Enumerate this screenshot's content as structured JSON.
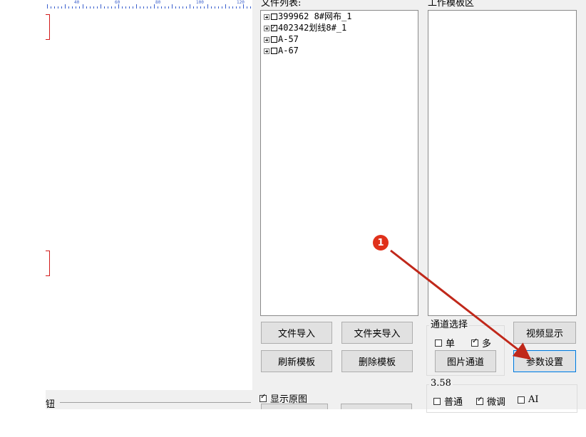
{
  "canvas": {
    "ruler_labels": [
      "40",
      "60",
      "80",
      "100",
      "120"
    ]
  },
  "bottom_strip": {
    "label": "钮"
  },
  "file_list": {
    "label": "文件列表:",
    "items": [
      {
        "name": "399962   8#网布_1",
        "checked": false
      },
      {
        "name": "402342划线8#_1",
        "checked": true
      },
      {
        "name": "A-57",
        "checked": false
      },
      {
        "name": "A-67",
        "checked": false
      }
    ]
  },
  "work_template": {
    "label": "工作模板区"
  },
  "buttons": {
    "file_import": "文件导入",
    "folder_import": "文件夹导入",
    "refresh_template": "刷新模板",
    "delete_template": "删除模板",
    "image_channel": "图片通道",
    "video_display": "视频显示",
    "param_settings": "参数设置"
  },
  "channel_select": {
    "label": "通道选择",
    "single": {
      "label": "单",
      "checked": false
    },
    "multi": {
      "label": "多",
      "checked": true
    }
  },
  "show_original": {
    "label": "显示原图",
    "checked": true
  },
  "status": {
    "value": "3.58",
    "normal": {
      "label": "普通",
      "checked": false
    },
    "fine_tune": {
      "label": "微调",
      "checked": true
    },
    "ai": {
      "label": "AI",
      "checked": false
    }
  },
  "annotation": {
    "number": "1",
    "color": "#e0311b"
  }
}
